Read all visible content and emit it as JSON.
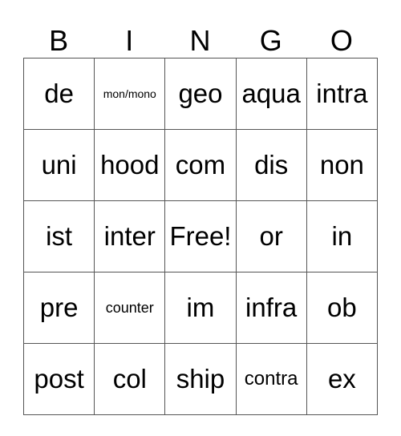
{
  "header": [
    "B",
    "I",
    "N",
    "G",
    "O"
  ],
  "rows": [
    [
      {
        "text": "de",
        "size": "l"
      },
      {
        "text": "mon/mono",
        "size": "xs"
      },
      {
        "text": "geo",
        "size": "l"
      },
      {
        "text": "aqua",
        "size": "l"
      },
      {
        "text": "intra",
        "size": "l"
      }
    ],
    [
      {
        "text": "uni",
        "size": "l"
      },
      {
        "text": "hood",
        "size": "l"
      },
      {
        "text": "com",
        "size": "l"
      },
      {
        "text": "dis",
        "size": "l"
      },
      {
        "text": "non",
        "size": "l"
      }
    ],
    [
      {
        "text": "ist",
        "size": "l"
      },
      {
        "text": "inter",
        "size": "l"
      },
      {
        "text": "Free!",
        "size": "l"
      },
      {
        "text": "or",
        "size": "l"
      },
      {
        "text": "in",
        "size": "l"
      }
    ],
    [
      {
        "text": "pre",
        "size": "l"
      },
      {
        "text": "counter",
        "size": "s"
      },
      {
        "text": "im",
        "size": "l"
      },
      {
        "text": "infra",
        "size": "l"
      },
      {
        "text": "ob",
        "size": "l"
      }
    ],
    [
      {
        "text": "post",
        "size": "l"
      },
      {
        "text": "col",
        "size": "l"
      },
      {
        "text": "ship",
        "size": "l"
      },
      {
        "text": "contra",
        "size": "m"
      },
      {
        "text": "ex",
        "size": "l"
      }
    ]
  ]
}
